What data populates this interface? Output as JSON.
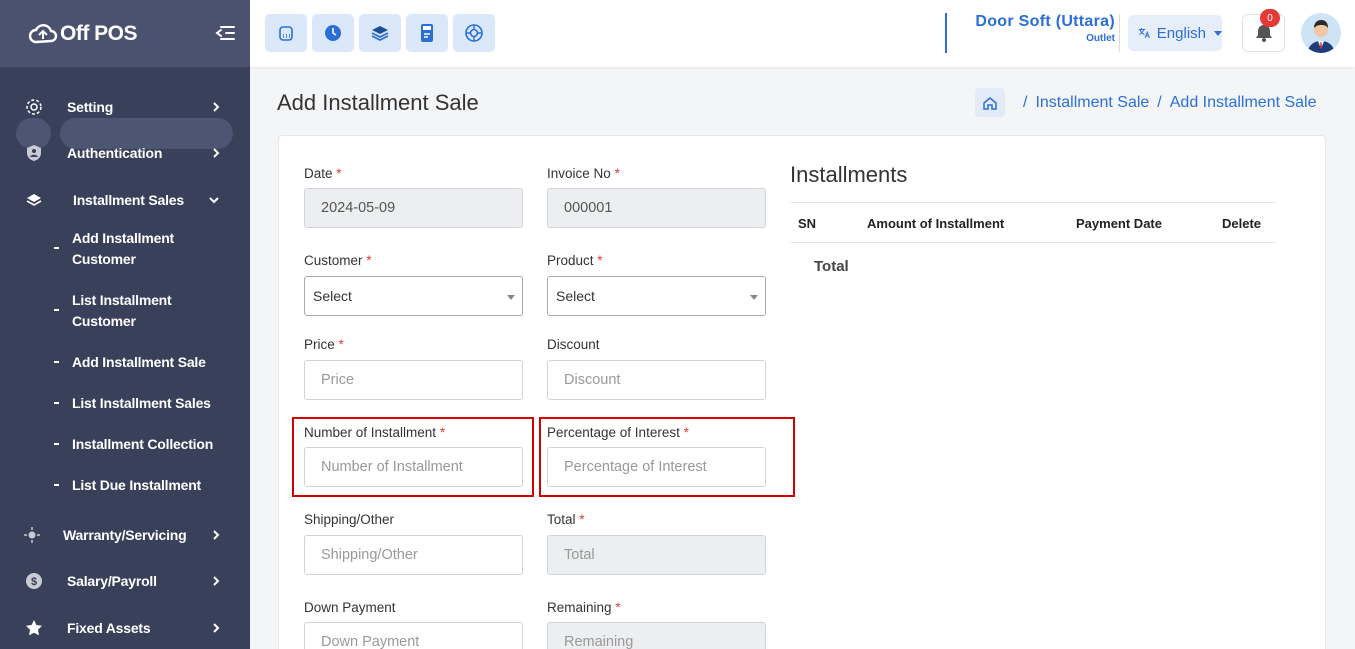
{
  "brand": {
    "name": "Off POS",
    "icon": "cloud-logo-icon"
  },
  "sidebar": {
    "items": [
      {
        "label": "Setting",
        "icon": "gear-icon"
      },
      {
        "label": "Authentication",
        "icon": "shield-user-icon"
      },
      {
        "label": "Installment Sales",
        "icon": "layers-icon",
        "expanded": true
      },
      {
        "label": "Warranty/Servicing",
        "icon": "sun-icon"
      },
      {
        "label": "Salary/Payroll",
        "icon": "dollar-icon"
      },
      {
        "label": "Fixed Assets",
        "icon": "star-icon"
      }
    ],
    "subitems": [
      {
        "label": "Add Installment Customer"
      },
      {
        "label": "List Installment Customer"
      },
      {
        "label": "Add Installment Sale"
      },
      {
        "label": "List Installment Sales"
      },
      {
        "label": "Installment Collection"
      },
      {
        "label": "List Due Installment"
      }
    ]
  },
  "topbar": {
    "quick_icons": [
      "pos-register-icon",
      "clock-icon",
      "stack-icon",
      "calculator-icon",
      "support-icon"
    ],
    "outlet_name": "Door Soft (Uttara)",
    "outlet_sub": "Outlet",
    "language": "English",
    "notification_count": "0"
  },
  "page": {
    "title": "Add Installment Sale",
    "breadcrumb": [
      "Installment Sale",
      "Add Installment Sale"
    ]
  },
  "form": {
    "date": {
      "label": "Date",
      "required": "*",
      "value": "2024-05-09"
    },
    "invoice": {
      "label": "Invoice No",
      "required": "*",
      "value": "000001"
    },
    "customer": {
      "label": "Customer",
      "required": "*",
      "value": "Select"
    },
    "product": {
      "label": "Product",
      "required": "*",
      "value": "Select"
    },
    "price": {
      "label": "Price",
      "required": "*",
      "placeholder": "Price"
    },
    "discount": {
      "label": "Discount",
      "placeholder": "Discount"
    },
    "num_installment": {
      "label": "Number of Installment",
      "required": "*",
      "placeholder": "Number of Installment"
    },
    "interest": {
      "label": "Percentage of Interest",
      "required": "*",
      "placeholder": "Percentage of Interest"
    },
    "shipping": {
      "label": "Shipping/Other",
      "placeholder": "Shipping/Other"
    },
    "total": {
      "label": "Total",
      "required": "*",
      "placeholder": "Total"
    },
    "down_payment": {
      "label": "Down Payment",
      "placeholder": "Down Payment"
    },
    "remaining": {
      "label": "Remaining",
      "required": "*",
      "placeholder": "Remaining"
    }
  },
  "installments": {
    "title": "Installments",
    "columns": [
      "SN",
      "Amount of Installment",
      "Payment Date",
      "Delete"
    ],
    "total_label": "Total"
  },
  "colors": {
    "sidebar": "#38405a",
    "accent": "#2b6fd6",
    "highlight": "#d40000"
  }
}
